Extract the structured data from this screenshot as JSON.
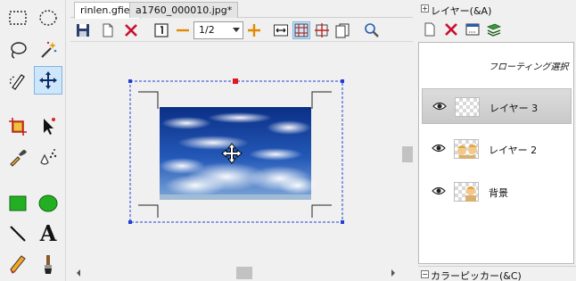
{
  "tools": [
    {
      "name": "rect-select-tool",
      "icon": "dashed-rectangle-icon"
    },
    {
      "name": "ellipse-select-tool",
      "icon": "dashed-ellipse-icon"
    },
    {
      "name": "lasso-tool",
      "icon": "lasso-icon"
    },
    {
      "name": "magic-wand-tool",
      "icon": "magic-wand-icon"
    },
    {
      "name": "freehand-select-tool",
      "icon": "pen-lasso-icon"
    },
    {
      "name": "move-tool",
      "icon": "move-arrows-icon",
      "active": true
    },
    {
      "name": "crop-tool",
      "icon": "crop-icon"
    },
    {
      "name": "pointer-tool",
      "icon": "arrow-pointer-icon"
    },
    {
      "name": "eyedropper-tool",
      "icon": "eyedropper-icon"
    },
    {
      "name": "fill-tool",
      "icon": "paint-drops-icon"
    },
    {
      "name": "rectangle-shape-tool",
      "icon": "green-square-icon"
    },
    {
      "name": "ellipse-shape-tool",
      "icon": "green-circle-icon"
    },
    {
      "name": "line-tool",
      "icon": "line-icon"
    },
    {
      "name": "text-tool",
      "icon": "letter-a-icon",
      "glyph": "A"
    },
    {
      "name": "pencil-tool",
      "icon": "pencil-icon"
    },
    {
      "name": "brush-tool",
      "icon": "brush-icon"
    }
  ],
  "tabs": [
    {
      "label": "rinlen.gfie*",
      "active": true
    },
    {
      "label": "a1760_000010.jpg*",
      "active": false
    }
  ],
  "doc_toolbar": {
    "zoom_value": "1/2",
    "icons": [
      "save-icon",
      "new-page-icon",
      "delete-icon",
      "actual-size-icon",
      "zoom-out-icon",
      "zoom-in-icon",
      "fit-width-icon",
      "grid-icon",
      "crosshair-guide-icon",
      "pages-icon",
      "magnifier-icon"
    ]
  },
  "right_panel": {
    "layer_header": "レイヤー(&A)",
    "layer_header_toggle": "+",
    "floating_label": "フローティング選択",
    "layers": [
      {
        "name": "レイヤー 3",
        "selected": true,
        "visible": true
      },
      {
        "name": "レイヤー 2",
        "selected": false,
        "visible": true
      },
      {
        "name": "背景",
        "selected": false,
        "visible": true
      }
    ],
    "color_header": "カラーピッカー(&C)",
    "color_header_toggle": "−"
  },
  "colors": {
    "accent": "#0078d7",
    "selection_dash": "#1f3fd6",
    "delete_red": "#c8102e",
    "zoom_orange": "#e08a00"
  }
}
